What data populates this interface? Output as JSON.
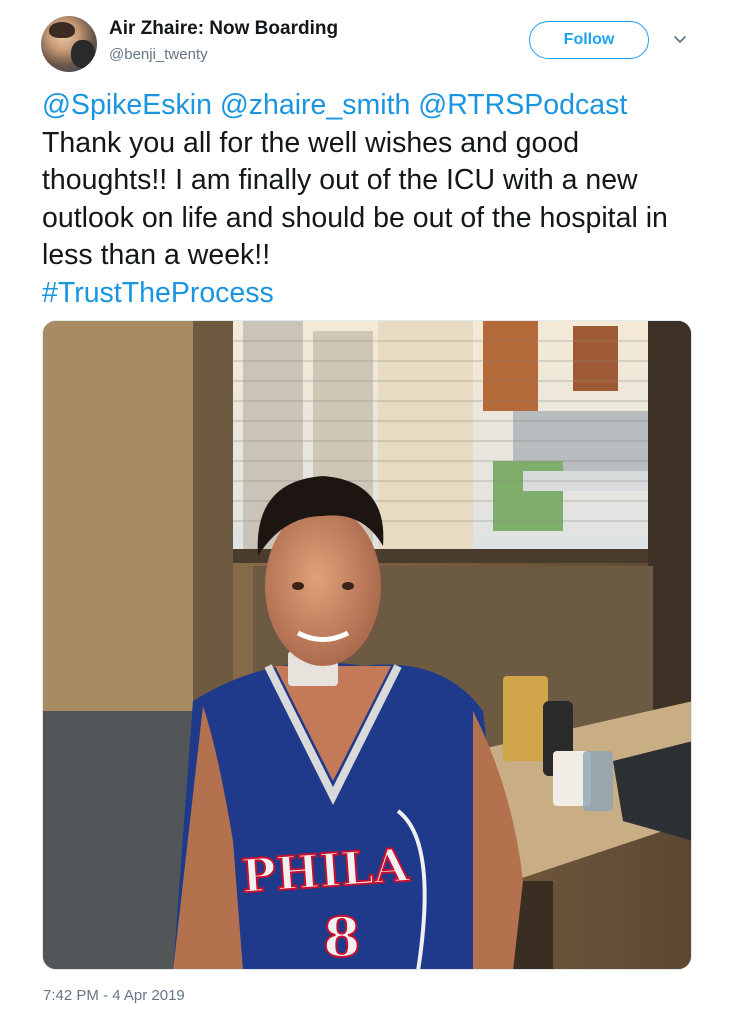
{
  "author": {
    "display_name": "Air Zhaire: Now Boarding",
    "handle": "@benji_twenty"
  },
  "follow_button": {
    "label": "Follow"
  },
  "tweet": {
    "mentions": [
      "@SpikeEskin",
      "@zhaire_smith",
      "@RTRSPodcast"
    ],
    "body": "Thank you all for the well wishes and good thoughts!!  I am finally out of the ICU with a new outlook on life and should be out of the hospital in less than a week!!",
    "hashtag": "#TrustTheProcess"
  },
  "photo": {
    "jersey_text": "PHILA",
    "jersey_number": "8"
  },
  "timestamp": "7:42 PM - 4 Apr 2019",
  "colors": {
    "link": "#1b95e0",
    "follow": "#1da1f2",
    "muted": "#657786",
    "text": "#14171a"
  },
  "icons": [
    "chevron-down-icon"
  ]
}
